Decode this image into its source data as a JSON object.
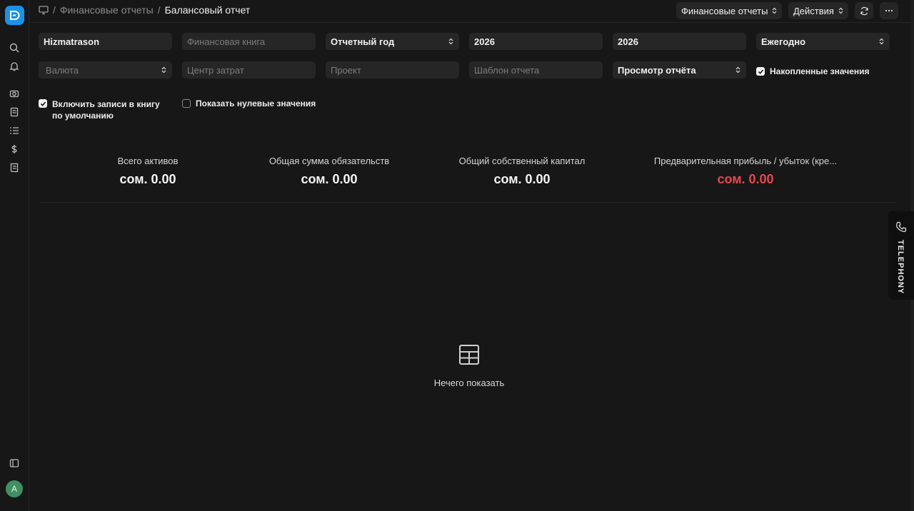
{
  "breadcrumbs": {
    "parent": "Финансовые отчеты",
    "current": "Балансовый отчет"
  },
  "top_actions": {
    "report_menu": "Финансовые отчеты",
    "actions_menu": "Действия"
  },
  "filters": {
    "company": "Hizmatrason",
    "finance_book_placeholder": "Финансовая книга",
    "period_type": "Отчетный год",
    "from_year": "2026",
    "to_year": "2026",
    "periodicity": "Ежегодно",
    "currency_placeholder": "Валюта",
    "cost_center_placeholder": "Центр затрат",
    "project_placeholder": "Проект",
    "report_template_placeholder": "Шаблон отчета",
    "report_view": "Просмотр отчёта",
    "accumulated_values": "Накопленные значения",
    "include_default_book": "Включить записи в книгу по умолчанию",
    "show_zero_values": "Показать нулевые значения"
  },
  "summary": [
    {
      "label": "Всего активов",
      "value": "сом. 0.00"
    },
    {
      "label": "Общая сумма обязательств",
      "value": "сом. 0.00"
    },
    {
      "label": "Общий собственный капитал",
      "value": "сом. 0.00"
    },
    {
      "label": "Предварительная прибыль / убыток (кре...",
      "value": "сом. 0.00"
    }
  ],
  "empty_state": {
    "message": "Нечего показать"
  },
  "telephony": {
    "label": "TELEPHONY"
  },
  "user": {
    "initial": "A"
  },
  "colors": {
    "accent": "#1e90e6",
    "negative": "#e5484d",
    "avatar": "#3f8f63"
  },
  "icons": [
    "monitor-icon",
    "search-icon",
    "bell-icon",
    "camera-icon",
    "notebook-icon",
    "list-icon",
    "dollar-icon",
    "receipt-icon",
    "sidebar-toggle-icon",
    "refresh-icon",
    "more-icon",
    "table-icon",
    "phone-icon"
  ]
}
